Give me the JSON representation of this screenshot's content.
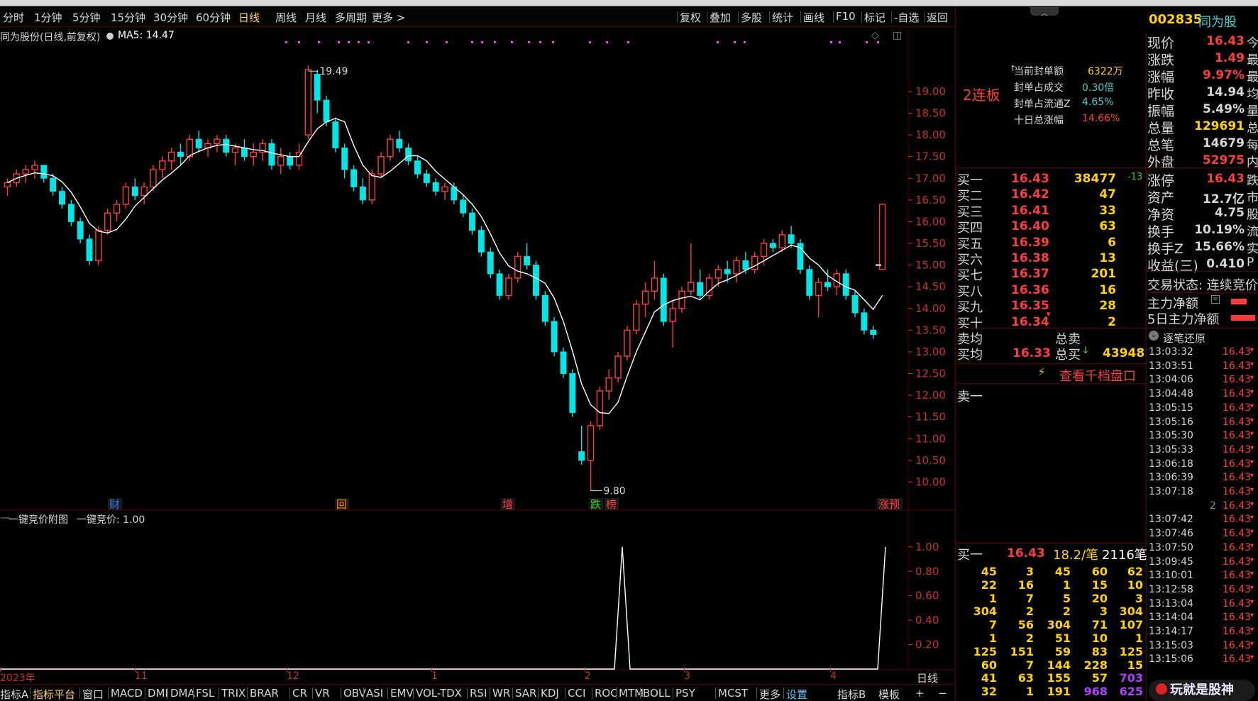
{
  "toolbar": {
    "left_items": [
      "分时",
      "1分钟",
      "5分钟",
      "15分钟",
      "30分钟",
      "60分钟",
      "日线",
      "周线",
      "月线",
      "多周期",
      "更多 >"
    ],
    "active": "日线",
    "right_items": [
      "复权",
      "叠加",
      "多股",
      "统计",
      "画线",
      "F10",
      "标记",
      "-自选",
      "返回"
    ]
  },
  "chart": {
    "title": "同为股份(日线,前复权)",
    "ma_label": "MA5: 14.47",
    "high_label": "19.49",
    "low_label": "9.80",
    "y_ticks": [
      "19.00",
      "18.50",
      "18.00",
      "17.50",
      "17.00",
      "16.50",
      "16.00",
      "15.50",
      "15.00",
      "14.50",
      "14.00",
      "13.50",
      "13.00",
      "12.50",
      "12.00",
      "11.50",
      "11.00",
      "10.50",
      "10.00"
    ],
    "markers": [
      {
        "text": "财",
        "color": "#2a7fff"
      },
      {
        "text": "回",
        "color": "#ff8a00"
      },
      {
        "text": "增",
        "color": "#ff3c3c"
      },
      {
        "text": "跌",
        "color": "#30d030"
      },
      {
        "text": "榜",
        "color": "#ff3c3c"
      },
      {
        "text": "涨预",
        "color": "#ff3c3c"
      }
    ]
  },
  "chart_data": {
    "type": "candlestick",
    "title": "同为股份(日线,前复权)",
    "ylim": [
      9.5,
      19.8
    ],
    "ma5_last": 14.47,
    "candles": [
      [
        16.8,
        17.0,
        16.6,
        16.9
      ],
      [
        16.9,
        17.2,
        16.8,
        17.1
      ],
      [
        17.1,
        17.3,
        16.9,
        17.2
      ],
      [
        17.2,
        17.4,
        17.0,
        17.3
      ],
      [
        17.3,
        17.3,
        16.9,
        17.0
      ],
      [
        17.0,
        17.1,
        16.6,
        16.7
      ],
      [
        16.7,
        16.8,
        16.3,
        16.4
      ],
      [
        16.4,
        16.5,
        15.9,
        16.0
      ],
      [
        16.0,
        16.1,
        15.5,
        15.6
      ],
      [
        15.6,
        15.7,
        15.0,
        15.1
      ],
      [
        15.1,
        15.9,
        15.0,
        15.8
      ],
      [
        15.8,
        16.3,
        15.7,
        16.2
      ],
      [
        16.2,
        16.5,
        16.0,
        16.4
      ],
      [
        16.4,
        16.9,
        16.3,
        16.8
      ],
      [
        16.8,
        17.0,
        16.5,
        16.6
      ],
      [
        16.6,
        16.9,
        16.4,
        16.8
      ],
      [
        16.8,
        17.3,
        16.7,
        17.2
      ],
      [
        17.2,
        17.5,
        17.0,
        17.4
      ],
      [
        17.4,
        17.7,
        17.2,
        17.6
      ],
      [
        17.6,
        17.8,
        17.3,
        17.5
      ],
      [
        17.5,
        18.0,
        17.4,
        17.9
      ],
      [
        17.9,
        18.1,
        17.6,
        17.7
      ],
      [
        17.7,
        17.9,
        17.5,
        17.8
      ],
      [
        17.8,
        18.0,
        17.6,
        17.9
      ],
      [
        17.9,
        18.0,
        17.5,
        17.6
      ],
      [
        17.6,
        17.8,
        17.3,
        17.7
      ],
      [
        17.7,
        17.9,
        17.4,
        17.5
      ],
      [
        17.5,
        17.8,
        17.3,
        17.6
      ],
      [
        17.6,
        17.9,
        17.4,
        17.8
      ],
      [
        17.8,
        17.9,
        17.2,
        17.3
      ],
      [
        17.3,
        17.7,
        17.1,
        17.5
      ],
      [
        17.5,
        17.6,
        17.2,
        17.3
      ],
      [
        17.3,
        17.8,
        17.2,
        17.6
      ],
      [
        18.0,
        19.6,
        17.9,
        19.5
      ],
      [
        19.4,
        19.5,
        18.5,
        18.8
      ],
      [
        18.8,
        18.9,
        18.2,
        18.3
      ],
      [
        18.3,
        18.4,
        17.6,
        17.7
      ],
      [
        17.7,
        17.8,
        17.0,
        17.2
      ],
      [
        17.2,
        17.3,
        16.7,
        16.8
      ],
      [
        16.8,
        17.0,
        16.4,
        16.5
      ],
      [
        16.5,
        17.2,
        16.4,
        17.1
      ],
      [
        17.1,
        17.6,
        17.0,
        17.5
      ],
      [
        17.5,
        18.0,
        17.4,
        17.9
      ],
      [
        17.9,
        18.1,
        17.6,
        17.7
      ],
      [
        17.7,
        17.8,
        17.3,
        17.4
      ],
      [
        17.4,
        17.5,
        17.0,
        17.1
      ],
      [
        17.1,
        17.2,
        16.8,
        16.9
      ],
      [
        16.9,
        17.0,
        16.6,
        16.7
      ],
      [
        16.7,
        16.9,
        16.5,
        16.8
      ],
      [
        16.8,
        16.9,
        16.4,
        16.5
      ],
      [
        16.5,
        16.6,
        16.1,
        16.2
      ],
      [
        16.2,
        16.3,
        15.7,
        15.8
      ],
      [
        15.8,
        15.9,
        15.2,
        15.3
      ],
      [
        15.3,
        15.4,
        14.7,
        14.8
      ],
      [
        14.8,
        14.9,
        14.2,
        14.3
      ],
      [
        14.3,
        14.8,
        14.2,
        14.7
      ],
      [
        14.7,
        15.3,
        14.6,
        15.2
      ],
      [
        15.2,
        15.5,
        14.9,
        15.0
      ],
      [
        15.0,
        15.1,
        14.2,
        14.3
      ],
      [
        14.3,
        14.4,
        13.6,
        13.7
      ],
      [
        13.7,
        13.8,
        12.9,
        13.0
      ],
      [
        13.0,
        13.1,
        12.4,
        12.5
      ],
      [
        12.5,
        12.6,
        11.5,
        11.6
      ],
      [
        10.7,
        11.3,
        10.4,
        10.5
      ],
      [
        10.5,
        11.4,
        9.8,
        11.3
      ],
      [
        11.3,
        12.2,
        11.2,
        12.1
      ],
      [
        12.1,
        12.6,
        11.9,
        12.4
      ],
      [
        12.4,
        13.0,
        12.3,
        12.9
      ],
      [
        12.9,
        13.6,
        12.8,
        13.5
      ],
      [
        13.5,
        14.2,
        13.4,
        14.1
      ],
      [
        14.1,
        14.6,
        13.8,
        14.4
      ],
      [
        14.4,
        15.1,
        14.2,
        14.7
      ],
      [
        14.7,
        14.8,
        13.6,
        13.7
      ],
      [
        13.7,
        14.2,
        13.1,
        14.0
      ],
      [
        14.0,
        14.5,
        13.9,
        14.4
      ],
      [
        14.4,
        15.5,
        14.3,
        14.6
      ],
      [
        14.6,
        14.9,
        14.2,
        14.3
      ],
      [
        14.3,
        14.8,
        14.2,
        14.7
      ],
      [
        14.7,
        15.0,
        14.5,
        14.9
      ],
      [
        14.9,
        15.1,
        14.6,
        14.8
      ],
      [
        14.8,
        15.2,
        14.6,
        15.1
      ],
      [
        15.1,
        15.3,
        14.8,
        14.9
      ],
      [
        14.9,
        15.3,
        14.8,
        15.2
      ],
      [
        15.2,
        15.6,
        15.0,
        15.5
      ],
      [
        15.5,
        15.6,
        15.3,
        15.4
      ],
      [
        15.4,
        15.8,
        15.3,
        15.7
      ],
      [
        15.7,
        15.9,
        15.4,
        15.5
      ],
      [
        15.5,
        15.6,
        14.8,
        14.9
      ],
      [
        14.9,
        15.0,
        14.2,
        14.3
      ],
      [
        14.3,
        14.7,
        13.8,
        14.6
      ],
      [
        14.6,
        14.9,
        14.4,
        14.5
      ],
      [
        14.5,
        14.9,
        14.3,
        14.8
      ],
      [
        14.8,
        14.9,
        14.2,
        14.3
      ],
      [
        14.3,
        14.4,
        13.8,
        13.9
      ],
      [
        13.9,
        14.0,
        13.4,
        13.5
      ],
      [
        13.5,
        13.6,
        13.3,
        13.4
      ],
      [
        14.9,
        16.4,
        14.9,
        16.4
      ]
    ],
    "auction_values": {
      "peak_1": 1.0,
      "peak_2": 1.0
    },
    "sub_y_ticks": [
      "1.00",
      "0.80",
      "0.60",
      "0.40",
      "0.20"
    ]
  },
  "subchart": {
    "title": "一键竞价附图",
    "value_label": "一键竞价: 1.00"
  },
  "date_axis": [
    "2023年",
    "11",
    "12",
    "1",
    "2",
    "3",
    "4"
  ],
  "indicators": [
    "指标A",
    "指标平台",
    "窗口",
    "MACD",
    "DMI",
    "DMA",
    "FSL",
    "TRIX",
    "BRAR",
    "CR",
    "VR",
    "OBV",
    "ASI",
    "EMV",
    "VOL-TDX",
    "RSI",
    "WR",
    "SAR",
    "KDJ",
    "CCI",
    "ROC",
    "MTM",
    "BOLL",
    "PSY",
    "MCST",
    "更多",
    "设置"
  ],
  "indicators_right": [
    "指标B",
    "模板",
    "+",
    "−"
  ],
  "footer_period": "日线",
  "right": {
    "code": "002835",
    "name": "同为股",
    "streak": "2连板",
    "seal_info": [
      {
        "label": "当前封单额",
        "value": "6322万",
        "color": "#ffd200"
      },
      {
        "label": "封单占成交",
        "value": "0.30倍",
        "color": "#3ad0d0"
      },
      {
        "label": "封单占流通Z",
        "value": "4.65%",
        "color": "#3ad0d0"
      },
      {
        "label": "十日总涨幅",
        "value": "14.66%",
        "color": "#ff3c3c"
      }
    ],
    "bids": [
      {
        "label": "买一",
        "price": "16.43",
        "vol": "38477",
        "chg": "-13"
      },
      {
        "label": "买二",
        "price": "16.42",
        "vol": "47",
        "chg": ""
      },
      {
        "label": "买三",
        "price": "16.41",
        "vol": "33",
        "chg": ""
      },
      {
        "label": "买四",
        "price": "16.40",
        "vol": "63",
        "chg": ""
      },
      {
        "label": "买五",
        "price": "16.39",
        "vol": "6",
        "chg": ""
      },
      {
        "label": "买六",
        "price": "16.38",
        "vol": "13",
        "chg": ""
      },
      {
        "label": "买七",
        "price": "16.37",
        "vol": "201",
        "chg": ""
      },
      {
        "label": "买八",
        "price": "16.36",
        "vol": "16",
        "chg": ""
      },
      {
        "label": "买九",
        "price": "16.35",
        "vol": "28",
        "chg": ""
      },
      {
        "label": "买十",
        "price": "16.34",
        "vol": "2",
        "chg": ""
      }
    ],
    "avg_sell_label": "卖均",
    "total_sell_label": "总卖",
    "avg_buy_label": "买均",
    "avg_buy_price": "16.33",
    "total_buy_label": "总买",
    "total_buy_value": "43948",
    "detail_link": "查看千档盘口",
    "sell_one": "卖一",
    "queue_header": {
      "label": "买一",
      "price": "16.43",
      "avg": "18.2/笔",
      "count": "2116笔"
    },
    "queue": [
      [
        "45",
        "3",
        "45",
        "60",
        "62"
      ],
      [
        "22",
        "16",
        "1",
        "15",
        "10"
      ],
      [
        "1",
        "7",
        "5",
        "20",
        "3"
      ],
      [
        "304",
        "2",
        "2",
        "3",
        "304"
      ],
      [
        "7",
        "56",
        "304",
        "71",
        "107"
      ],
      [
        "1",
        "2",
        "51",
        "10",
        "1"
      ],
      [
        "125",
        "151",
        "59",
        "83",
        "125"
      ],
      [
        "60",
        "7",
        "144",
        "228",
        "15"
      ],
      [
        "41",
        "63",
        "155",
        "57",
        "703"
      ],
      [
        "32",
        "1",
        "191",
        "968",
        "625"
      ]
    ],
    "stats": [
      {
        "label": "现价",
        "value": "16.43",
        "extra": "今",
        "color": "#ff3c3c"
      },
      {
        "label": "涨跌",
        "value": "1.49",
        "extra": "最",
        "color": "#ff3c3c"
      },
      {
        "label": "涨幅",
        "value": "9.97%",
        "extra": "最",
        "color": "#ff3c3c"
      },
      {
        "label": "昨收",
        "value": "14.94",
        "extra": "均",
        "color": "#d6d6d6"
      },
      {
        "label": "振幅",
        "value": "5.49%",
        "extra": "量",
        "color": "#d6d6d6"
      },
      {
        "label": "总量",
        "value": "129691",
        "extra": "总",
        "color": "#ffd200"
      },
      {
        "label": "总笔",
        "value": "14679",
        "extra": "每",
        "color": "#d6d6d6"
      },
      {
        "label": "外盘",
        "value": "52975",
        "extra": "内",
        "color": "#ff3c3c"
      }
    ],
    "stats2": [
      {
        "label": "涨停",
        "value": "16.43",
        "extra": "跌",
        "color": "#ff3c3c"
      },
      {
        "label": "资产",
        "value": "12.7亿",
        "extra": "市",
        "color": "#d6d6d6"
      },
      {
        "label": "净资",
        "value": "4.75",
        "extra": "股",
        "color": "#d6d6d6"
      },
      {
        "label": "换手",
        "value": "10.19%",
        "extra": "流",
        "color": "#d6d6d6"
      },
      {
        "label": "换手Z",
        "value": "15.66%",
        "extra": "实",
        "color": "#d6d6d6"
      },
      {
        "label": "收益(三)",
        "value": "0.410",
        "extra": "P",
        "color": "#d6d6d6"
      }
    ],
    "trade_status": "交易状态: 连续竞价",
    "main_net": "主力净额",
    "main_net5": "5日主力净额",
    "ticks_header": "逐笔还原",
    "ticks": [
      {
        "time": "13:03:32",
        "price": "16.43"
      },
      {
        "time": "13:03:51",
        "price": "16.43"
      },
      {
        "time": "13:04:06",
        "price": "16.43"
      },
      {
        "time": "13:04:48",
        "price": "16.43"
      },
      {
        "time": "13:05:15",
        "price": "16.43"
      },
      {
        "time": "13:05:16",
        "price": "16.43"
      },
      {
        "time": "13:05:30",
        "price": "16.43"
      },
      {
        "time": "13:05:33",
        "price": "16.43"
      },
      {
        "time": "13:06:18",
        "price": "16.43"
      },
      {
        "time": "13:06:39",
        "price": "16.43"
      },
      {
        "time": "13:07:18",
        "price": "16.43"
      },
      {
        "time": "2",
        "price": "16.43"
      },
      {
        "time": "13:07:42",
        "price": "16.43"
      },
      {
        "time": "13:07:46",
        "price": "16.43"
      },
      {
        "time": "13:07:50",
        "price": "16.43"
      },
      {
        "time": "13:09:45",
        "price": "16.43"
      },
      {
        "time": "13:10:01",
        "price": "16.43"
      },
      {
        "time": "13:12:58",
        "price": "16.43"
      },
      {
        "time": "13:13:04",
        "price": "16.43"
      },
      {
        "time": "13:14:04",
        "price": "16.43"
      },
      {
        "time": "13:14:17",
        "price": "16.43"
      },
      {
        "time": "13:15:03",
        "price": "16.43"
      },
      {
        "time": "13:15:06",
        "price": "16.43"
      }
    ],
    "watermark": "玩就是股神"
  },
  "colors": {
    "up": "#ff3c3c",
    "down": "#00e5e5",
    "ma": "#ffffff",
    "grid": "#5a0000",
    "axis": "#c83030"
  }
}
